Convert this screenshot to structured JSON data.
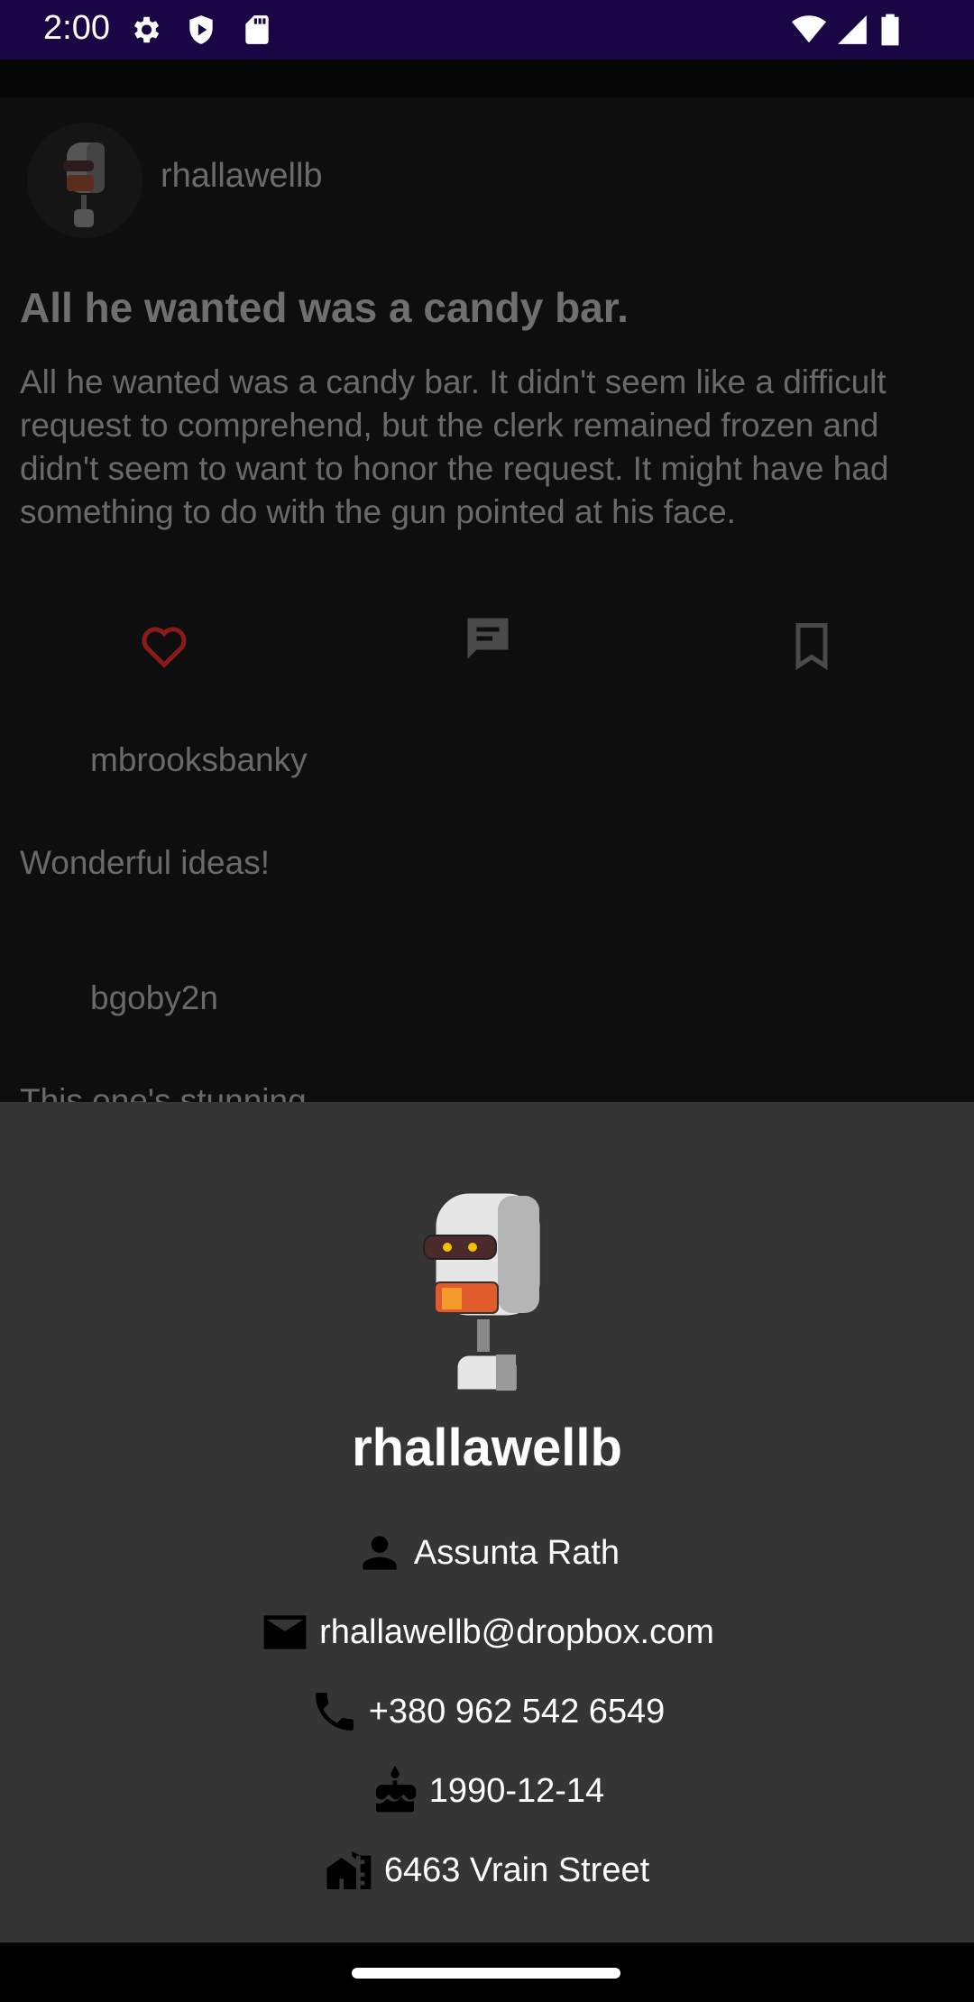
{
  "status_bar": {
    "time": "2:00",
    "icons": [
      "settings-icon",
      "shield-play-icon",
      "sd-card-icon",
      "wifi-icon",
      "cell-signal-icon",
      "battery-icon"
    ]
  },
  "post": {
    "username": "rhallawellb",
    "title": "All he wanted was a candy bar.",
    "body": "All he wanted was a candy bar. It didn't seem like a difficult request to comprehend, but the clerk remained frozen and didn't seem to want to honor the request. It might have had something to do with the gun pointed at his face.",
    "actions": [
      "heart-icon",
      "comment-icon",
      "bookmark-icon"
    ],
    "like_color": "#8b1a1a"
  },
  "comments": [
    {
      "username": "mbrooksbanky",
      "text": "Wonderful ideas!"
    },
    {
      "username": "bgoby2n",
      "text": "This one's stunning"
    }
  ],
  "profile_sheet": {
    "username": "rhallawellb",
    "name": "Assunta Rath",
    "email": "rhallawellb@dropbox.com",
    "phone": "+380 962 542 6549",
    "birthday": "1990-12-14",
    "address": "6463 Vrain Street"
  },
  "colors": {
    "status_bar": "#1a0645",
    "sheet_background": "#353535",
    "scrim_feed": "#0e0e0e"
  }
}
